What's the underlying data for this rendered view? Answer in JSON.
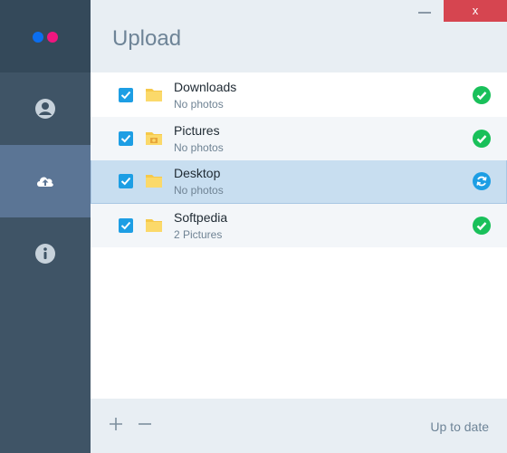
{
  "app": {
    "title": "Upload",
    "brand_colors": {
      "blue": "#0b6ef0",
      "pink": "#f0167f"
    },
    "close_label": "x"
  },
  "sidebar": {
    "items": [
      {
        "name": "account",
        "icon": "user-icon",
        "active": false
      },
      {
        "name": "upload",
        "icon": "cloud-upload-icon",
        "active": true
      },
      {
        "name": "info",
        "icon": "info-icon",
        "active": false
      }
    ]
  },
  "folders": [
    {
      "name": "Downloads",
      "subtitle": "No photos",
      "checked": true,
      "status": "done-icon"
    },
    {
      "name": "Pictures",
      "subtitle": "No photos",
      "checked": true,
      "status": "done-icon"
    },
    {
      "name": "Desktop",
      "subtitle": "No photos",
      "checked": true,
      "status": "syncing-icon",
      "selected": true
    },
    {
      "name": "Softpedia",
      "subtitle": "2 Pictures",
      "checked": true,
      "status": "done-icon"
    }
  ],
  "footer": {
    "add_icon": "plus-icon",
    "remove_icon": "minus-icon",
    "status": "Up to date"
  }
}
